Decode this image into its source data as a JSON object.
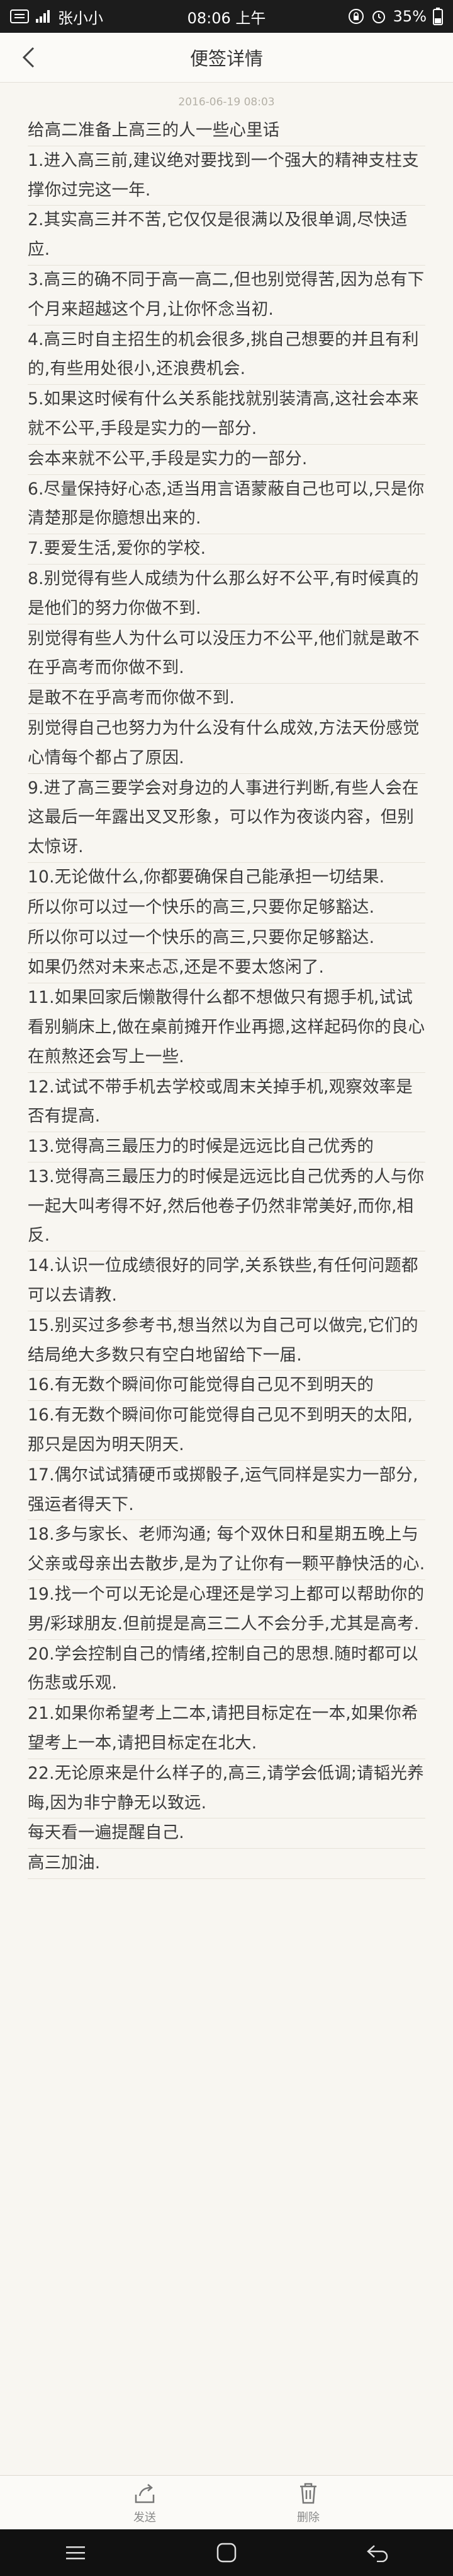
{
  "status_bar": {
    "carrier": "张小小",
    "time": "08:06 上午",
    "battery": "35%"
  },
  "header": {
    "title": "便签详情"
  },
  "note": {
    "date": "2016-06-19 08:03",
    "lines": [
      "给高二准备上高三的人一些心里话",
      "1.进入高三前,建议绝对要找到一个强大的精神支柱支撑你过完这一年.",
      "2.其实高三并不苦,它仅仅是很满以及很单调,尽快适应.",
      "3.高三的确不同于高一高二,但也别觉得苦,因为总有下个月来超越这个月,让你怀念当初.",
      "4.高三时自主招生的机会很多,挑自己想要的并且有利的,有些用处很小,还浪费机会.",
      "5.如果这时候有什么关系能找就别装清高,这社会本来就不公平,手段是实力的一部分.",
      "会本来就不公平,手段是实力的一部分.",
      "6.尽量保持好心态,适当用言语蒙蔽自己也可以,只是你清楚那是你臆想出来的.",
      "7.要爱生活,爱你的学校.",
      "8.别觉得有些人成绩为什么那么好不公平,有时候真的是他们的努力你做不到.",
      "别觉得有些人为什么可以没压力不公平,他们就是敢不在乎高考而你做不到.",
      "是敢不在乎高考而你做不到.",
      "别觉得自己也努力为什么没有什么成效,方法天份感觉心情每个都占了原因.",
      "9.进了高三要学会对身边的人事进行判断,有些人会在这最后一年露出叉叉形象，可以作为夜谈内容，但别太惊讶.",
      "10.无论做什么,你都要确保自己能承担一切结果.",
      "所以你可以过一个快乐的高三,只要你足够豁达.",
      "所以你可以过一个快乐的高三,只要你足够豁达.",
      "如果仍然对未来忐忑,还是不要太悠闲了.",
      "11.如果回家后懒散得什么都不想做只有摁手机,试试看别躺床上,做在桌前摊开作业再摁,这样起码你的良心在煎熬还会写上一些.",
      "12.试试不带手机去学校或周末关掉手机,观察效率是否有提高.",
      "13.觉得高三最压力的时候是远远比自己优秀的",
      "13.觉得高三最压力的时候是远远比自己优秀的人与你一起大叫考得不好,然后他卷子仍然非常美好,而你,相反.",
      "14.认识一位成绩很好的同学,关系铁些,有任何问题都可以去请教.",
      "15.别买过多参考书,想当然以为自己可以做完,它们的结局绝大多数只有空白地留给下一届.",
      "16.有无数个瞬间你可能觉得自己见不到明天的",
      "16.有无数个瞬间你可能觉得自己见不到明天的太阳,那只是因为明天阴天.",
      "17.偶尔试试猜硬币或掷骰子,运气同样是实力一部分,强运者得天下.",
      "18.多与家长、老师沟通; 每个双休日和星期五晚上与父亲或母亲出去散步,是为了让你有一颗平静快活的心.",
      "19.找一个可以无论是心理还是学习上都可以帮助你的男/彩球朋友.但前提是高三二人不会分手,尤其是高考.",
      "20.学会控制自己的情绪,控制自己的思想.随时都可以伤悲或乐观.",
      "21.如果你希望考上二本,请把目标定在一本,如果你希望考上一本,请把目标定在北大.",
      "22.无论原来是什么样子的,高三,请学会低调;请韬光养晦,因为非宁静无以致远.",
      "每天看一遍提醒自己.",
      "高三加油."
    ]
  },
  "actions": {
    "send_label": "发送",
    "delete_label": "删除"
  }
}
